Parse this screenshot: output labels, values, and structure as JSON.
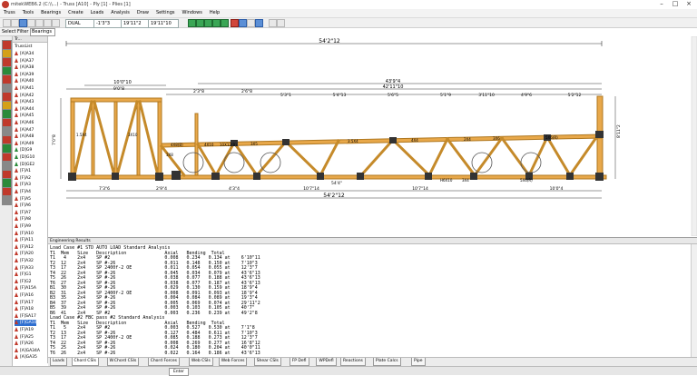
{
  "window": {
    "title": "mitekWEB6.2 (C:\\\\...) - Truss [A10] - Ply [1] - Plies [1]",
    "minimize_label": "–",
    "maximize_label": "□",
    "close_label": "×"
  },
  "menu": [
    "Truss",
    "Tools",
    "Bearings",
    "Create",
    "Loads",
    "Analysis",
    "Draw",
    "Settings",
    "Windows",
    "Help"
  ],
  "toolbar": {
    "field_a": "DUAL",
    "field_b": "-1'3\"3",
    "field_c": "19'11\"2",
    "field_d": "19'11\"10"
  },
  "filter": {
    "label": "Select Filter",
    "value": "Bearings"
  },
  "tree": {
    "header": "Tr...",
    "root": "TrussList",
    "items": [
      {
        "label": "[A]A34",
        "color": "red"
      },
      {
        "label": "[A]A37",
        "color": "red"
      },
      {
        "label": "[A]A38",
        "color": "red"
      },
      {
        "label": "[A]A39",
        "color": "red"
      },
      {
        "label": "[A]A40",
        "color": "red"
      },
      {
        "label": "[A]A41",
        "color": "red"
      },
      {
        "label": "[A]A42",
        "color": "red"
      },
      {
        "label": "[A]A43",
        "color": "red"
      },
      {
        "label": "[A]A44",
        "color": "red"
      },
      {
        "label": "[A]A45",
        "color": "red"
      },
      {
        "label": "[A]A46",
        "color": "red"
      },
      {
        "label": "[A]A47",
        "color": "red"
      },
      {
        "label": "[A]A48",
        "color": "red"
      },
      {
        "label": "[A]A49",
        "color": "red"
      },
      {
        "label": "[D]G9",
        "color": "green"
      },
      {
        "label": "[D]G10",
        "color": "green"
      },
      {
        "label": "[D]GE2",
        "color": "green"
      },
      {
        "label": "[F]A1",
        "color": "red"
      },
      {
        "label": "[F]A2",
        "color": "red"
      },
      {
        "label": "[F]A3",
        "color": "red"
      },
      {
        "label": "[F]A4",
        "color": "red"
      },
      {
        "label": "[F]A5",
        "color": "red"
      },
      {
        "label": "[F]A6",
        "color": "red"
      },
      {
        "label": "[F]A7",
        "color": "red"
      },
      {
        "label": "[F]A8",
        "color": "red"
      },
      {
        "label": "[F]A9",
        "color": "red"
      },
      {
        "label": "[F]A10",
        "color": "red"
      },
      {
        "label": "[F]A11",
        "color": "red"
      },
      {
        "label": "[F]A12",
        "color": "red"
      },
      {
        "label": "[F]A20",
        "color": "red"
      },
      {
        "label": "[F]A32",
        "color": "red"
      },
      {
        "label": "[F]A33",
        "color": "red"
      },
      {
        "label": "[F]G1",
        "color": "red"
      },
      {
        "label": "[F]G2",
        "color": "red"
      },
      {
        "label": "[F]A15A",
        "color": "red"
      },
      {
        "label": "[F]A16",
        "color": "red"
      },
      {
        "label": "[F]A17",
        "color": "red"
      },
      {
        "label": "[F]A18",
        "color": "red"
      },
      {
        "label": "[F]SA17",
        "color": "red"
      },
      {
        "label": "[F]GA10",
        "color": "red",
        "selected": true
      },
      {
        "label": "[F]A19",
        "color": "red"
      },
      {
        "label": "[F]A25",
        "color": "red"
      },
      {
        "label": "[F]A26",
        "color": "red"
      },
      {
        "label": "[A]GA34A",
        "color": "red"
      },
      {
        "label": "[A]GA35",
        "color": "red"
      }
    ]
  },
  "drawing": {
    "overall_top": "54'2\"12",
    "overall_top2": "43'9\"4",
    "overall_top3": "42'11\"10",
    "left_span": "10'0\"10",
    "left_sub": "9'0\"8",
    "seg_top": [
      "2'3\"8",
      "2'6\"8",
      "5'3\"1",
      "5'4\"13",
      "5'6\"5",
      "5'1\"9",
      "3'11\"10",
      "4'9\"6",
      "5'2\"12"
    ],
    "bottom_dims": [
      "7'3\"6",
      "2'9\"4",
      "4'3\"4",
      "10'7\"14",
      "10'7\"14",
      "10'0\"4"
    ],
    "bottom_overall": "54'2\"12",
    "bottom_mid": "54'4\"",
    "left_height": "7'0\"8",
    "right_height": "8'11\"2",
    "labels": [
      "1.5X4",
      "3X10",
      "3X8",
      "4X8(B)",
      "4X10",
      "10X12(B)",
      "3X5",
      "3.5X4",
      "4X4",
      "2X4",
      "H6X10",
      "3X4",
      "3X6",
      "5X6(R)",
      "5X6(R)"
    ]
  },
  "engineering": {
    "header": "Engineering Results",
    "lines": [
      "Load Case #1 STD AUTO LOAD Standard Analysis",
      "T1  Mem   Size   Description              Axial   Bending  Total",
      "T1   4    2x4    SP #2                    0.008   0.234   0.134 at    6'10\"11",
      "T2  12    2x4    SP #-26                  0.011   0.148   0.150 at    7'10\"3",
      "T3  17    2x4    SP 2400f-2 OE            0.011   0.054   0.055 at    12'3\"7",
      "T4  22    2x4    SP #-26                  0.045   0.034   0.079 at    43'6\"13",
      "T5  26    2x4    SP #-26                  0.038   0.077   0.188 at    43'6\"13",
      "T6  27    2x4    SP #-26                  0.038   0.077   0.187 at    43'6\"13",
      "B1  30    2x4    SP #-26                  0.029   0.130   0.159 at    18'9\"4",
      "B2  31    2x4    SP 2400f-2 OE            0.008   0.091   0.093 at    18'9\"4",
      "B3  35    2x4    SP #-26                  0.004   0.084   0.089 at    19'3\"4",
      "B4  37    2x4    SP #-26                  0.005   0.069   0.074 at    29'11\"2",
      "B5  39    2x4    SP #-26                  0.003   0.103   0.105 at    40'7\"",
      "B6  41    2x4    SP #2                    0.003   0.236   0.239 at    49'2\"8",
      "",
      "Load Case #2 FBC pass #2 Standard Analysis",
      "T1  Mem   Size   Description              Axial   Bending  Total",
      "T1   5    2x4    SP #2                    0.003   0.527   0.530 at    7'1\"8",
      "T2  13    2x4    SP #-26                  0.127   0.484   0.611 at    7'10\"3",
      "T3  17    2x4    SP 2400f-2 OE            0.085   0.188   0.273 at    12'3\"7",
      "T4  22    2x4    SP #-26                  0.008   0.269   0.277 at    16'8\"12",
      "T5  25    2x4    SP #-26                  0.024   0.180   0.204 at    40'0\"11",
      "T6  26    2x4    SP #-26                  0.022   0.164   0.186 at    43'6\"13"
    ]
  },
  "tabs": [
    "Loads",
    "Chord CSIs",
    "W.Chord CSIs",
    "Chord Forces",
    "Web CSIs",
    "Web Forces",
    "Shear CSIs",
    "FP Defl",
    "WPDefl",
    "Reactions",
    "Plate Calcs",
    "Pipe"
  ],
  "status": {
    "mode": "Enter"
  }
}
